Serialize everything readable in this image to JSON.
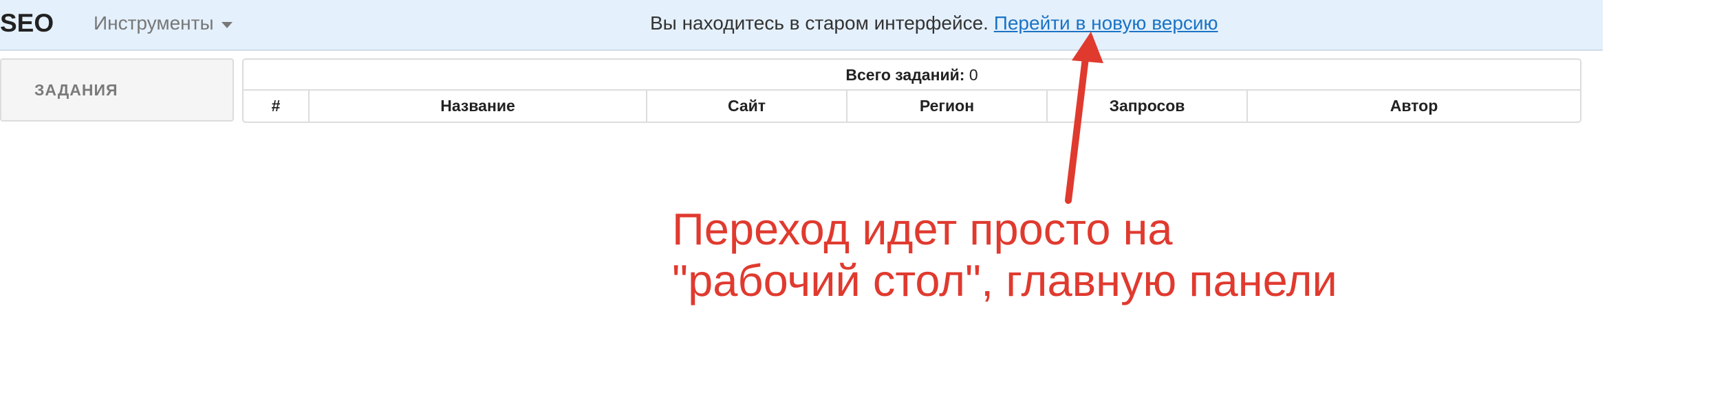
{
  "header": {
    "brand": "SEO",
    "tools_menu": "Инструменты",
    "notice_text": "Вы находитесь в старом интерфейсе. ",
    "notice_link": "Перейти в новую версию"
  },
  "sidebar": {
    "tasks_label": "ЗАДАНИЯ"
  },
  "table": {
    "total_label": "Всего заданий:",
    "total_value": "0",
    "columns": [
      "#",
      "Название",
      "Сайт",
      "Регион",
      "Запросов",
      "Автор"
    ]
  },
  "annotation": {
    "line1": "Переход идет просто на",
    "line2": "\"рабочий стол\", главную панели",
    "color": "#e03a2f"
  }
}
